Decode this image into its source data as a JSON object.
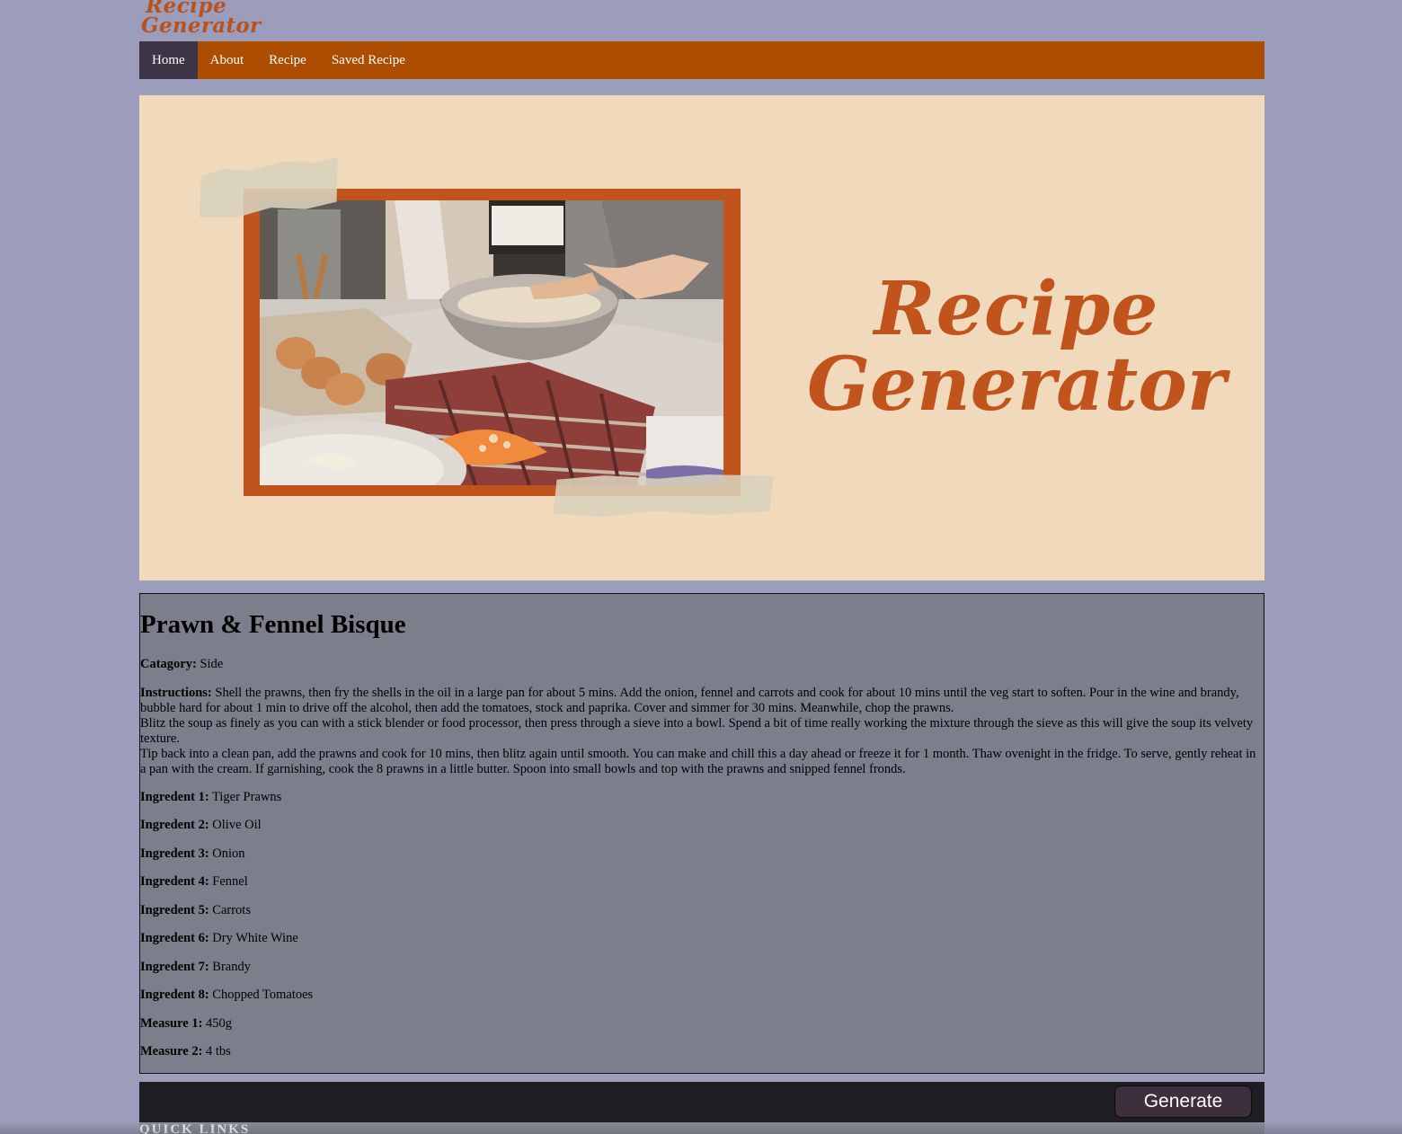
{
  "logo": {
    "line1": "Recipe",
    "line2": "Generator"
  },
  "nav": {
    "items": [
      {
        "label": "Home"
      },
      {
        "label": "About"
      },
      {
        "label": "Recipe"
      },
      {
        "label": "Saved Recipe"
      }
    ],
    "active": "Home"
  },
  "hero": {
    "title_line1": "Recipe",
    "title_line2": "Generator"
  },
  "recipe": {
    "title": "Prawn & Fennel Bisque",
    "category_label": "Catagory:",
    "category": "Side",
    "instructions_label": "Instructions:",
    "instructions": [
      "Shell the prawns, then fry the shells in the oil in a large pan for about 5 mins. Add the onion, fennel and carrots and cook for about 10 mins until the veg start to soften. Pour in the wine and brandy, bubble hard for about 1 min to drive off the alcohol, then add the tomatoes, stock and paprika. Cover and simmer for 30 mins. Meanwhile, chop the prawns.",
      "Blitz the soup as finely as you can with a stick blender or food processor, then press through a sieve into a bowl. Spend a bit of time really working the mixture through the sieve as this will give the soup its velvety texture.",
      "Tip back into a clean pan, add the prawns and cook for 10 mins, then blitz again until smooth. You can make and chill this a day ahead or freeze it for 1 month. Thaw ovenight in the fridge. To serve, gently reheat in a pan with the cream. If garnishing, cook the 8 prawns in a little butter. Spoon into small bowls and top with the prawns and snipped fennel fronds."
    ],
    "fields": [
      {
        "label": "Ingredent 1:",
        "value": "Tiger Prawns"
      },
      {
        "label": "Ingredent 2:",
        "value": "Olive Oil"
      },
      {
        "label": "Ingredent 3:",
        "value": "Onion"
      },
      {
        "label": "Ingredent 4:",
        "value": "Fennel"
      },
      {
        "label": "Ingredent 5:",
        "value": "Carrots"
      },
      {
        "label": "Ingredent 6:",
        "value": "Dry White Wine"
      },
      {
        "label": "Ingredent 7:",
        "value": "Brandy"
      },
      {
        "label": "Ingredent 8:",
        "value": "Chopped Tomatoes"
      },
      {
        "label": "Measure 1:",
        "value": "450g"
      },
      {
        "label": "Measure 2:",
        "value": "4 tbs"
      }
    ]
  },
  "footer": {
    "generate_label": "Generate",
    "quick_links_label": "QUICK LINKS"
  },
  "colors": {
    "page_bg": "#9b9dba",
    "nav_bg": "#ac4d02",
    "nav_active": "#3d3546",
    "hero_bg": "#f1dabc",
    "brand_orange": "#c1531d",
    "card_bg": "#7c7e8b",
    "footer_bg": "#1d1d22",
    "button_bg": "#3d2f3b"
  }
}
